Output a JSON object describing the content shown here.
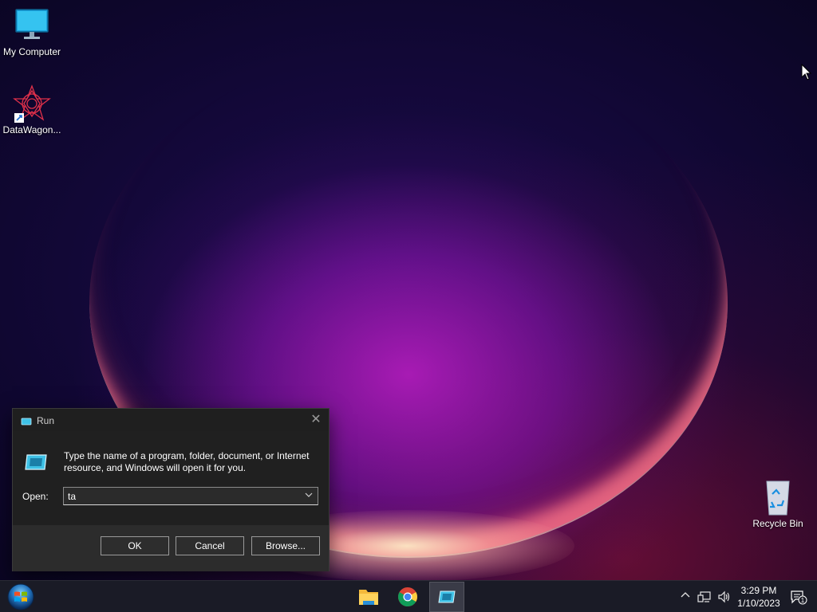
{
  "desktop": {
    "icons": [
      {
        "label": "My Computer"
      },
      {
        "label": "DataWagon..."
      },
      {
        "label": "Recycle Bin"
      }
    ]
  },
  "run_dialog": {
    "title": "Run",
    "description": "Type the name of a program, folder, document, or Internet resource, and Windows will open it for you.",
    "open_label": "Open:",
    "open_value": "ta",
    "buttons": {
      "ok": "OK",
      "cancel": "Cancel",
      "browse": "Browse..."
    }
  },
  "taskbar": {
    "apps": [
      "folder-icon",
      "chrome-icon",
      "run-icon"
    ],
    "active_app": "run-icon",
    "clock": {
      "time": "3:29 PM",
      "date": "1/10/2023"
    },
    "notification_count": "1"
  },
  "colors": {
    "dialog_bg": "#1f1f1f",
    "taskbar_bg": "#1a1b26",
    "accent": "#3ec1e6"
  }
}
